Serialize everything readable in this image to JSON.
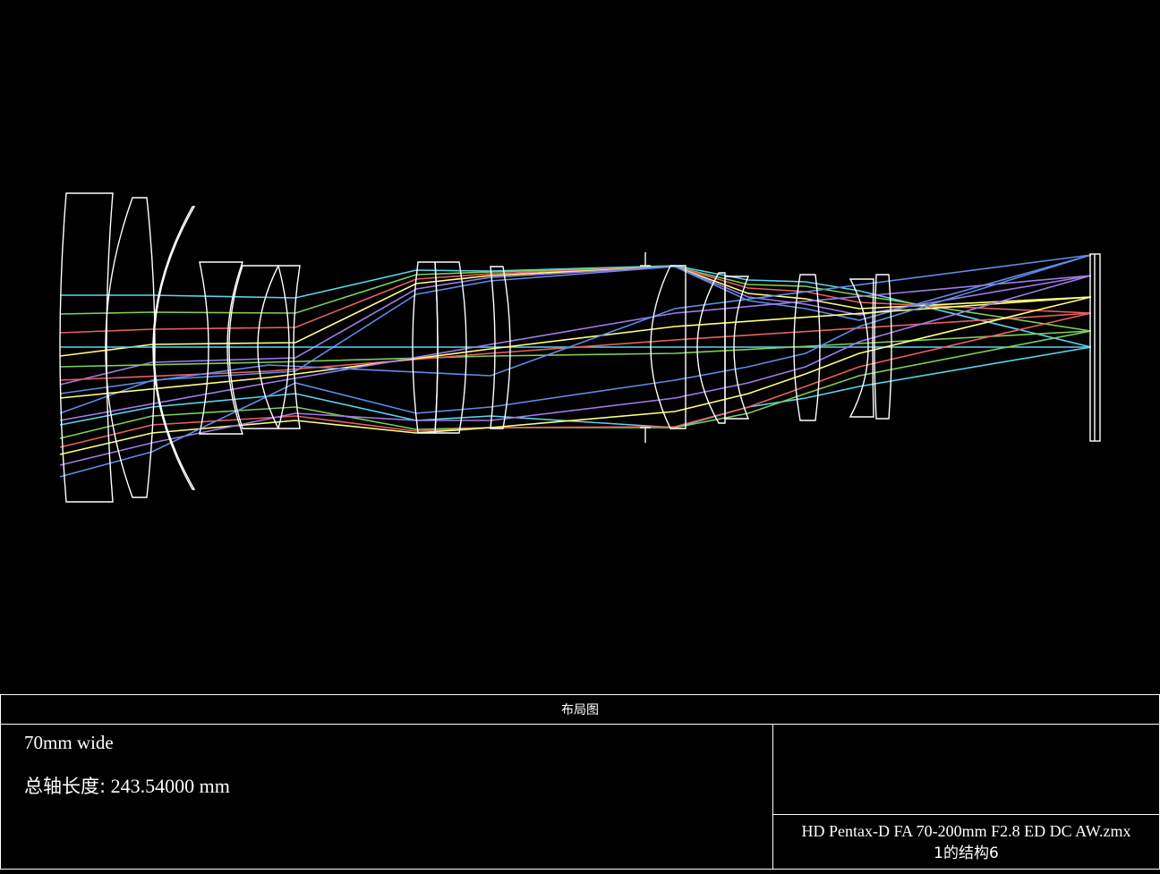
{
  "colors": {
    "background": "#000000",
    "element_outline": "#ffffff",
    "rays": [
      "#5bd4f0",
      "#7ccf5a",
      "#e86060",
      "#ffff80",
      "#a07be8",
      "#5e8ce8"
    ]
  },
  "footer": {
    "title": "布局图",
    "configuration": "70mm wide",
    "total_length_label": "总轴长度:",
    "total_length_value": "243.54000 mm",
    "file_name": "HD Pentax-D FA 70-200mm F2.8 ED DC AW.zmx",
    "config_line": "1的结构6"
  }
}
